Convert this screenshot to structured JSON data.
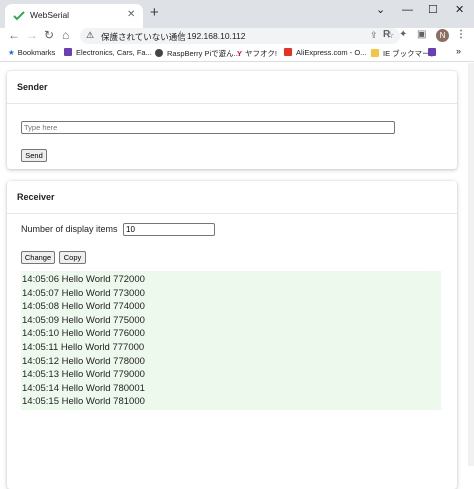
{
  "browser": {
    "tab_title": "WebSerial",
    "tab_close": "✕",
    "new_tab": "+",
    "window_controls": {
      "collapse": "⌄",
      "minimize": "—",
      "maximize": "☐",
      "close": "✕"
    },
    "nav": {
      "back": "←",
      "forward": "→",
      "reload": "↻",
      "home": "⌂"
    },
    "address": {
      "warning_icon": "⚠",
      "security_label": "保護されていない通信",
      "url": "192.168.10.112"
    },
    "avatar_letter": "N"
  },
  "bookmarks": [
    {
      "label": "Bookmarks",
      "icon": "★",
      "color": "#1a73e8"
    },
    {
      "label": "Electronics, Cars, Fa...",
      "color": "#6a3fb5"
    },
    {
      "label": "RaspBerry Piで遊ん...",
      "color": "#444444"
    },
    {
      "label": "ヤフオク!",
      "color": "#ff0033"
    },
    {
      "label": "AliExpress.com - O...",
      "color": "#e43225"
    },
    {
      "label": "IE ブックマーク",
      "color": "#f4c542"
    }
  ],
  "sender": {
    "title": "Sender",
    "input_placeholder": "Type here",
    "send_label": "Send"
  },
  "receiver": {
    "title": "Receiver",
    "count_label": "Number of display items",
    "count_value": "10",
    "change_label": "Change",
    "copy_label": "Copy",
    "lines": [
      "14:05:06 Hello World 772000",
      "14:05:07 Hello World 773000",
      "14:05:08 Hello World 774000",
      "14:05:09 Hello World 775000",
      "14:05:10 Hello World 776000",
      "14:05:11 Hello World 777000",
      "14:05:12 Hello World 778000",
      "14:05:13 Hello World 779000",
      "14:05:14 Hello World 780001",
      "14:05:15 Hello World 781000"
    ]
  }
}
